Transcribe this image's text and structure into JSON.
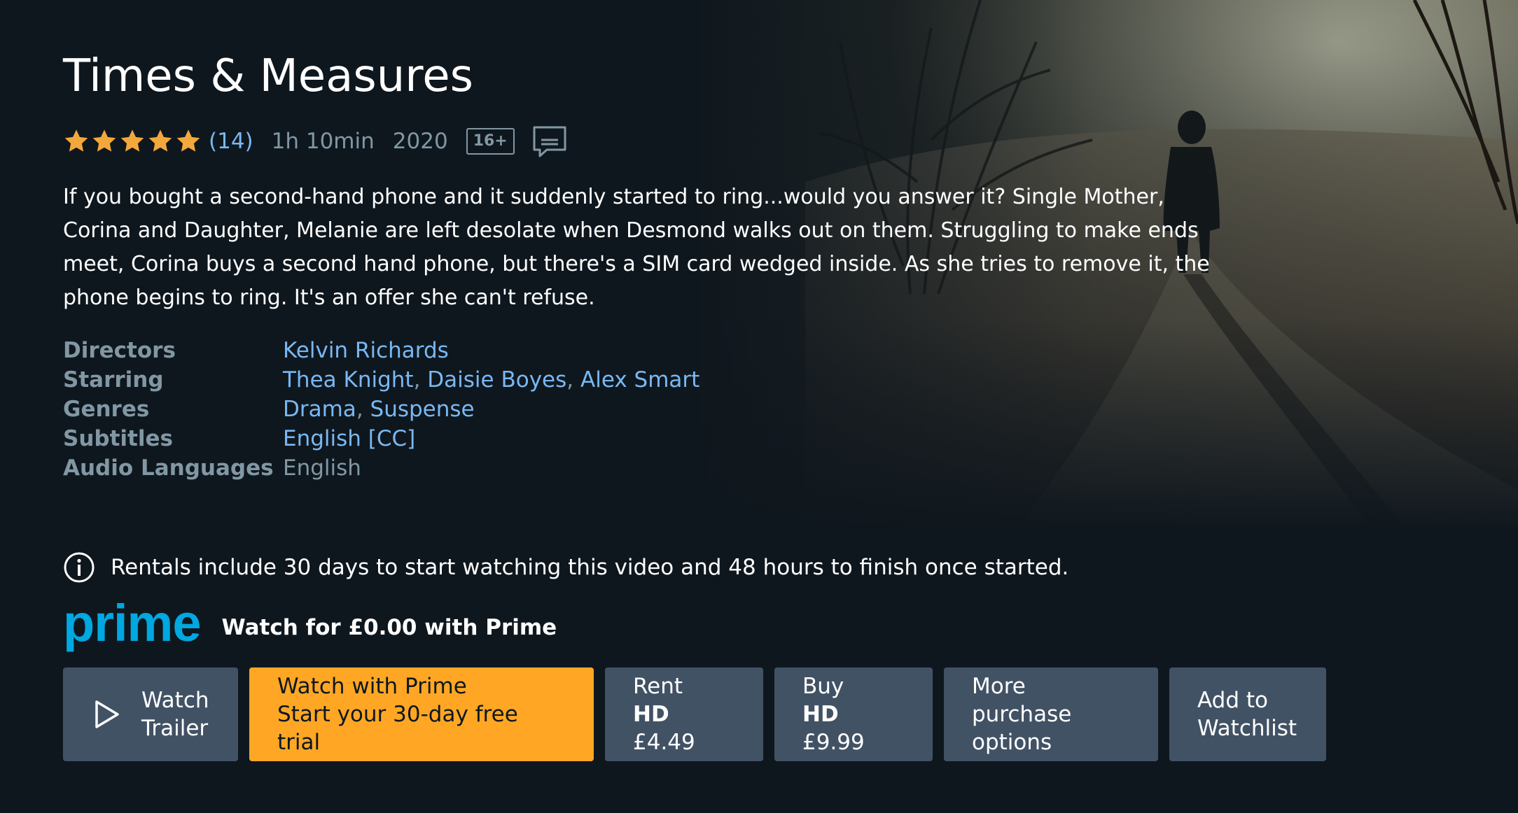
{
  "title": "Times & Measures",
  "meta": {
    "rating_stars": 5,
    "rating_count": "(14)",
    "runtime": "1h 10min",
    "year": "2020",
    "age_rating": "16+",
    "subtitles_icon": "subtitles-icon"
  },
  "synopsis": "If you bought a second-hand phone and it suddenly started to ring...would you answer it? Single Mother, Corina and Daughter, Melanie are left desolate when Desmond walks out on them. Struggling to make ends meet, Corina buys a second hand phone, but there's a SIM card wedged inside. As she tries to remove it, the phone begins to ring. It's an offer she can't refuse.",
  "details": {
    "directors_label": "Directors",
    "directors": [
      "Kelvin Richards"
    ],
    "starring_label": "Starring",
    "starring": [
      "Thea Knight",
      "Daisie Boyes",
      "Alex Smart"
    ],
    "genres_label": "Genres",
    "genres": [
      "Drama",
      "Suspense"
    ],
    "subtitles_label": "Subtitles",
    "subtitles": [
      "English [CC]"
    ],
    "audio_label": "Audio Languages",
    "audio": "English"
  },
  "notice": {
    "icon": "info-icon",
    "text": "Rentals include 30 days to start watching this video and 48 hours to finish once started."
  },
  "prime": {
    "logo_text": "prime",
    "offer": "Watch for £0.00 with Prime"
  },
  "actions": {
    "trailer": {
      "line1": "Watch",
      "line2": "Trailer",
      "icon": "play-icon"
    },
    "prime": {
      "line1": "Watch with Prime",
      "line2": "Start your 30-day free trial"
    },
    "rent": {
      "line1": "Rent",
      "quality": "HD",
      "price": "£4.49"
    },
    "buy": {
      "line1": "Buy",
      "quality": "HD",
      "price": "£9.99"
    },
    "more": {
      "line1": "More purchase",
      "line2": "options"
    },
    "watchlist": {
      "line1": "Add to",
      "line2": "Watchlist"
    }
  },
  "colors": {
    "background": "#0f171e",
    "link": "#79b8f3",
    "muted": "#8197a4",
    "button": "#425265",
    "prime_button": "#ffa724",
    "prime_blue": "#00a8e1",
    "star": "#f3a83b"
  }
}
